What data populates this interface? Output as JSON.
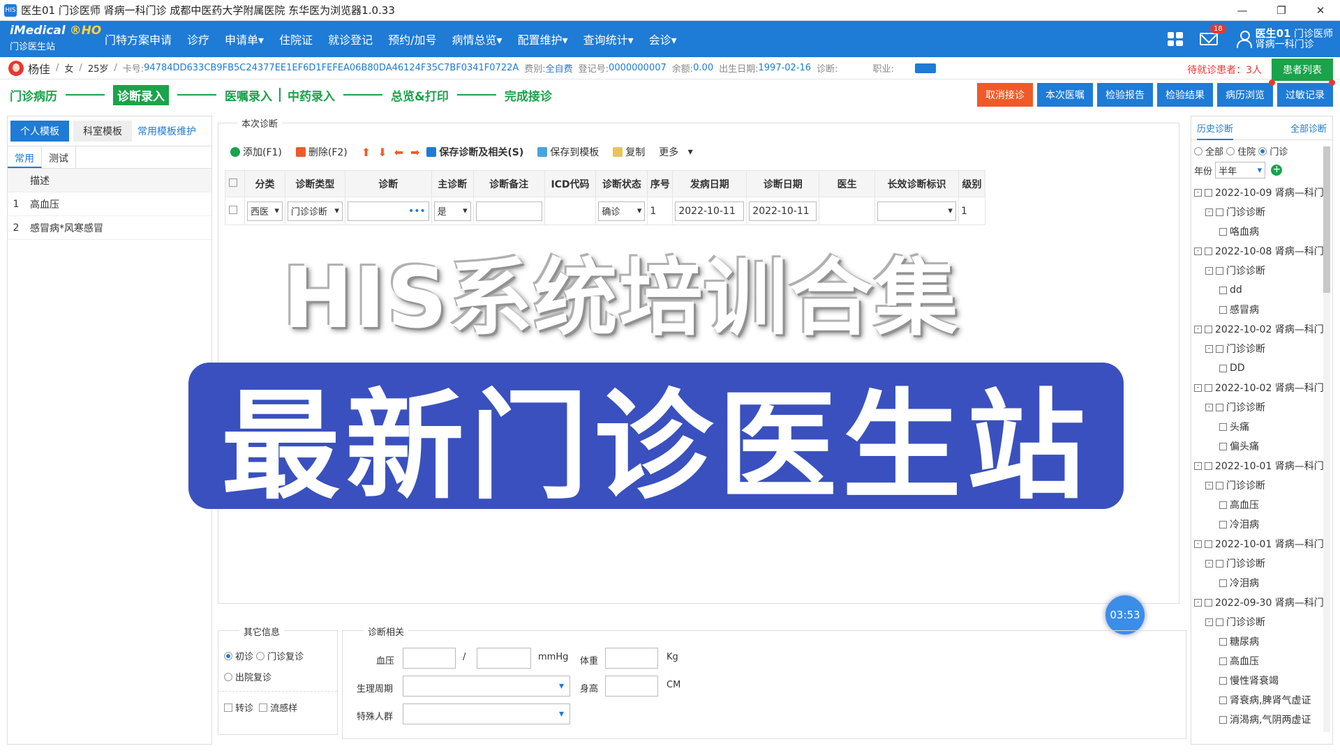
{
  "window": {
    "title": "医生01 门诊医师 肾病一科门诊 成都中医药大学附属医院 东华医为浏览器1.0.33",
    "icon_text": "HIS"
  },
  "logo": {
    "brand_a": "iMedical",
    "brand_b": "®HO",
    "subtitle": "门诊医生站"
  },
  "nav": [
    "门特方案申请",
    "诊疗",
    "申请单▾",
    "住院证",
    "就诊登记",
    "预约/加号",
    "病情总览▾",
    "配置维护▾",
    "查询统计▾",
    "会诊▾"
  ],
  "user": {
    "name": "医生01",
    "role": "门诊医师",
    "dept": "肾病一科门诊",
    "mail_count": "18"
  },
  "patient": {
    "name": "杨佳",
    "sep": "/",
    "sex": "女",
    "age": "25岁",
    "card_label": "卡号:",
    "card": "94784DD633CB9FB5C24377EE1EF6D1FEFEA06B80DA46124F35C7BF0341F0722A",
    "fee_label": "费别:",
    "fee": "全自费",
    "reg_label": "登记号:",
    "reg": "0000000007",
    "bal_label": "余额:",
    "bal": "0.00",
    "dob_label": "出生日期:",
    "dob": "1997-02-16",
    "diag_label": "诊断:",
    "job_label": "职业:",
    "waiting": "待就诊患者：3人",
    "patient_list": "患者列表"
  },
  "steps": [
    "门诊病历",
    "诊断录入",
    "医嘱录入",
    "中药录入",
    "总览&打印",
    "完成接诊"
  ],
  "actions": [
    "取消接诊",
    "本次医嘱",
    "检验报告",
    "检验结果",
    "病历浏览",
    "过敏记录"
  ],
  "left": {
    "tabs": [
      "个人模板",
      "科室模板",
      "常用模板维护"
    ],
    "subtabs": [
      "常用",
      "测试"
    ],
    "header": "描述",
    "rows": [
      {
        "no": "1",
        "desc": "高血压"
      },
      {
        "no": "2",
        "desc": "感冒病*风寒感冒"
      }
    ]
  },
  "center": {
    "title": "本次诊断",
    "toolbar": {
      "add": "添加(F1)",
      "del": "删除(F2)",
      "save": "保存诊断及相关(S)",
      "tpl": "保存到模板",
      "copy": "复制",
      "more": "更多"
    },
    "columns": [
      "分类",
      "诊断类型",
      "诊断",
      "主诊断",
      "诊断备注",
      "ICD代码",
      "诊断状态",
      "序号",
      "发病日期",
      "诊断日期",
      "医生",
      "长效诊断标识",
      "级别"
    ],
    "row": {
      "cat": "西医",
      "type": "门诊诊断",
      "diag_btn": "•••",
      "main": "是",
      "status": "确诊",
      "seq": "1",
      "onset": "2022-10-11",
      "date": "2022-10-11",
      "level": "1"
    }
  },
  "overlay": {
    "line1": "HIS系统培训合集",
    "line2": "最新门诊医生站"
  },
  "timer": "03:53",
  "other": {
    "title": "其它信息",
    "first": "初诊",
    "revisit": "门诊复诊",
    "discharge": "出院复诊",
    "transfer": "转诊",
    "flu": "流感样"
  },
  "diagrel": {
    "title": "诊断相关",
    "bp": "血压",
    "slash": "/",
    "mmhg": "mmHg",
    "weight": "体重",
    "kg": "Kg",
    "cycle": "生理周期",
    "height": "身高",
    "cm": "CM",
    "special": "特殊人群"
  },
  "right": {
    "tab1": "历史诊断",
    "tab2": "全部诊断",
    "f_all": "全部",
    "f_in": "住院",
    "f_out": "门诊",
    "year_label": "年份",
    "year": "半年",
    "visits": [
      {
        "d": "2022-10-09 肾病—科门",
        "items": [
          "咯血病"
        ]
      },
      {
        "d": "2022-10-08 肾病—科门",
        "items": [
          "dd",
          "感冒病"
        ]
      },
      {
        "d": "2022-10-02 肾病—科门",
        "items": [
          "DD"
        ]
      },
      {
        "d": "2022-10-02 肾病—科门",
        "items": [
          "头痛",
          "偏头痛"
        ]
      },
      {
        "d": "2022-10-01 肾病—科门",
        "items": [
          "高血压",
          "冷泪病"
        ]
      },
      {
        "d": "2022-10-01 肾病—科门",
        "items": [
          "冷泪病"
        ]
      },
      {
        "d": "2022-09-30 肾病—科门",
        "items": [
          "糖尿病",
          "高血压",
          "慢性肾衰竭",
          "肾衰病,脾肾气虚证",
          "消渴病,气阴两虚证"
        ]
      }
    ],
    "sub": "门诊诊断"
  }
}
